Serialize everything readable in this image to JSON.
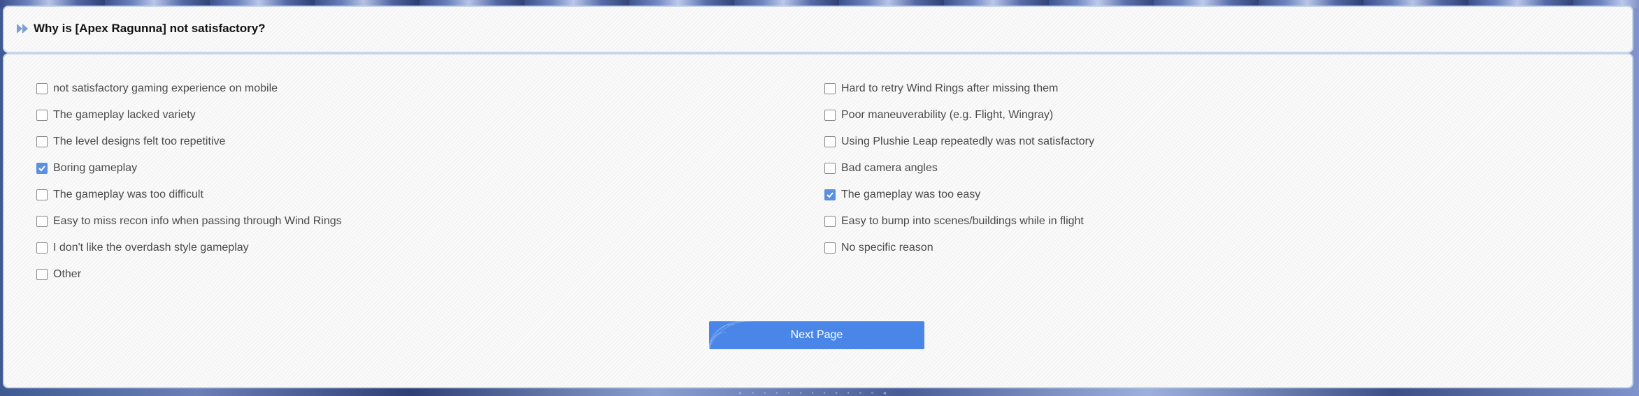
{
  "question": {
    "title": "Why is [Apex Ragunna] not satisfactory?",
    "icon": "double-arrow-icon"
  },
  "options_left": [
    {
      "label": "not satisfactory gaming experience on mobile",
      "checked": false
    },
    {
      "label": "The gameplay lacked variety",
      "checked": false
    },
    {
      "label": "The level designs felt too repetitive",
      "checked": false
    },
    {
      "label": "Boring gameplay",
      "checked": true
    },
    {
      "label": "The gameplay was too difficult",
      "checked": false
    },
    {
      "label": "Easy to miss recon info when passing through Wind Rings",
      "checked": false
    },
    {
      "label": "I don't like the overdash style gameplay",
      "checked": false
    },
    {
      "label": "Other",
      "checked": false
    }
  ],
  "options_right": [
    {
      "label": "Hard to retry Wind Rings after missing them",
      "checked": false
    },
    {
      "label": "Poor maneuverability (e.g. Flight, Wingray)",
      "checked": false
    },
    {
      "label": "Using Plushie Leap repeatedly was not satisfactory",
      "checked": false
    },
    {
      "label": "Bad camera angles",
      "checked": false
    },
    {
      "label": "The gameplay was too easy",
      "checked": true
    },
    {
      "label": "Easy to bump into scenes/buildings while in flight",
      "checked": false
    },
    {
      "label": "No specific reason",
      "checked": false
    }
  ],
  "next_button": {
    "label": "Next Page"
  },
  "colors": {
    "accent": "#4a86e8",
    "checkbox_checked": "#5b8fe0",
    "card_border": "#c9d6ea"
  }
}
